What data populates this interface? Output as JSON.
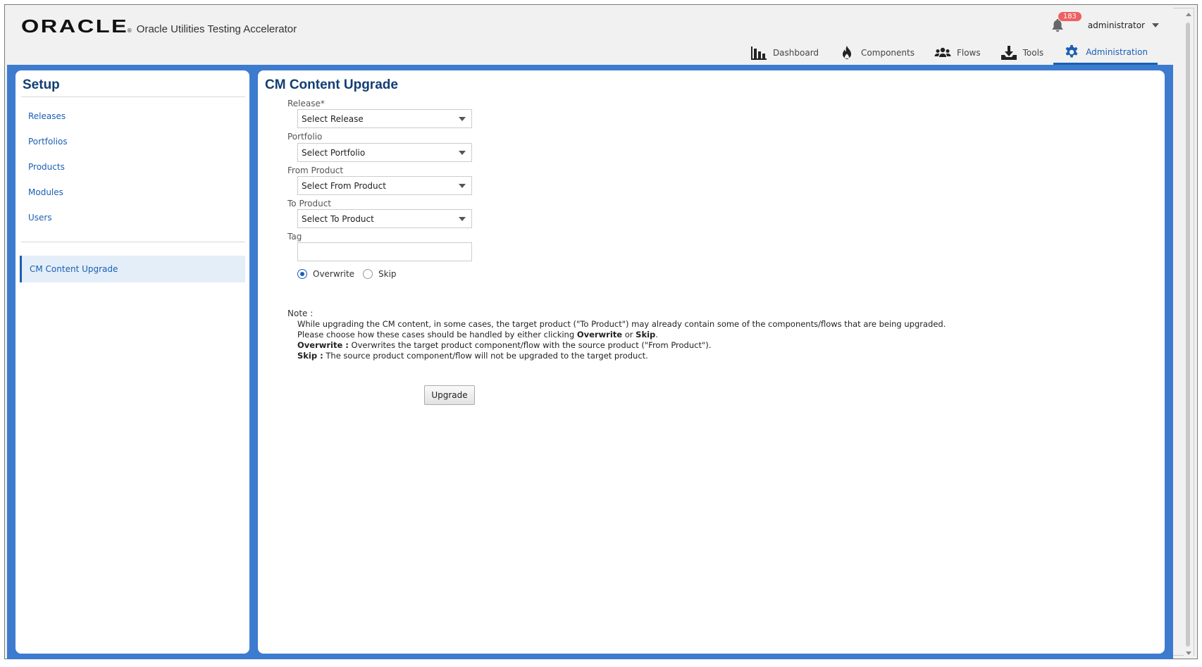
{
  "header": {
    "brand": "ORACLE",
    "brand_mark": "®",
    "app_title": "Oracle Utilities Testing Accelerator",
    "notification_count": "183",
    "user": "administrator"
  },
  "nav": [
    {
      "label": "Dashboard",
      "icon": "bar-chart-icon"
    },
    {
      "label": "Components",
      "icon": "fire-icon"
    },
    {
      "label": "Flows",
      "icon": "group-icon"
    },
    {
      "label": "Tools",
      "icon": "download-icon"
    },
    {
      "label": "Administration",
      "icon": "gear-icon",
      "active": true
    }
  ],
  "sidebar": {
    "title": "Setup",
    "items": [
      {
        "label": "Releases"
      },
      {
        "label": "Portfolios"
      },
      {
        "label": "Products"
      },
      {
        "label": "Modules"
      },
      {
        "label": "Users"
      }
    ],
    "selected_item": "CM Content Upgrade"
  },
  "form": {
    "title": "CM Content Upgrade",
    "release_label": "Release*",
    "release_value": "Select Release",
    "portfolio_label": "Portfolio",
    "portfolio_value": "Select Portfolio",
    "from_product_label": "From Product",
    "from_product_value": "Select From Product",
    "to_product_label": "To Product",
    "to_product_value": "Select To Product",
    "tag_label": "Tag",
    "tag_value": "",
    "overwrite_label": "Overwrite",
    "skip_label": "Skip",
    "selected_option": "Overwrite",
    "upgrade_button": "Upgrade"
  },
  "note": {
    "label": "Note :",
    "line1": "While upgrading the CM content, in some cases, the target product (\"To Product\") may already contain some of the components/flows that are being upgraded.",
    "line2_prefix": "Please choose how these cases should be handled by either clicking ",
    "line2_overwrite": "Overwrite",
    "line2_or": " or ",
    "line2_skip": "Skip",
    "line2_end": ".",
    "line3_bold": "Overwrite :",
    "line3_text": " Overwrites the target product component/flow with the source product (\"From Product\").",
    "line4_bold": "Skip :",
    "line4_text": " The source product component/flow will not be upgraded to the target product."
  },
  "colors": {
    "accent": "#1a5fb4",
    "stage_bg": "#3d7bcf",
    "title": "#123e73",
    "badge": "#f06060"
  }
}
